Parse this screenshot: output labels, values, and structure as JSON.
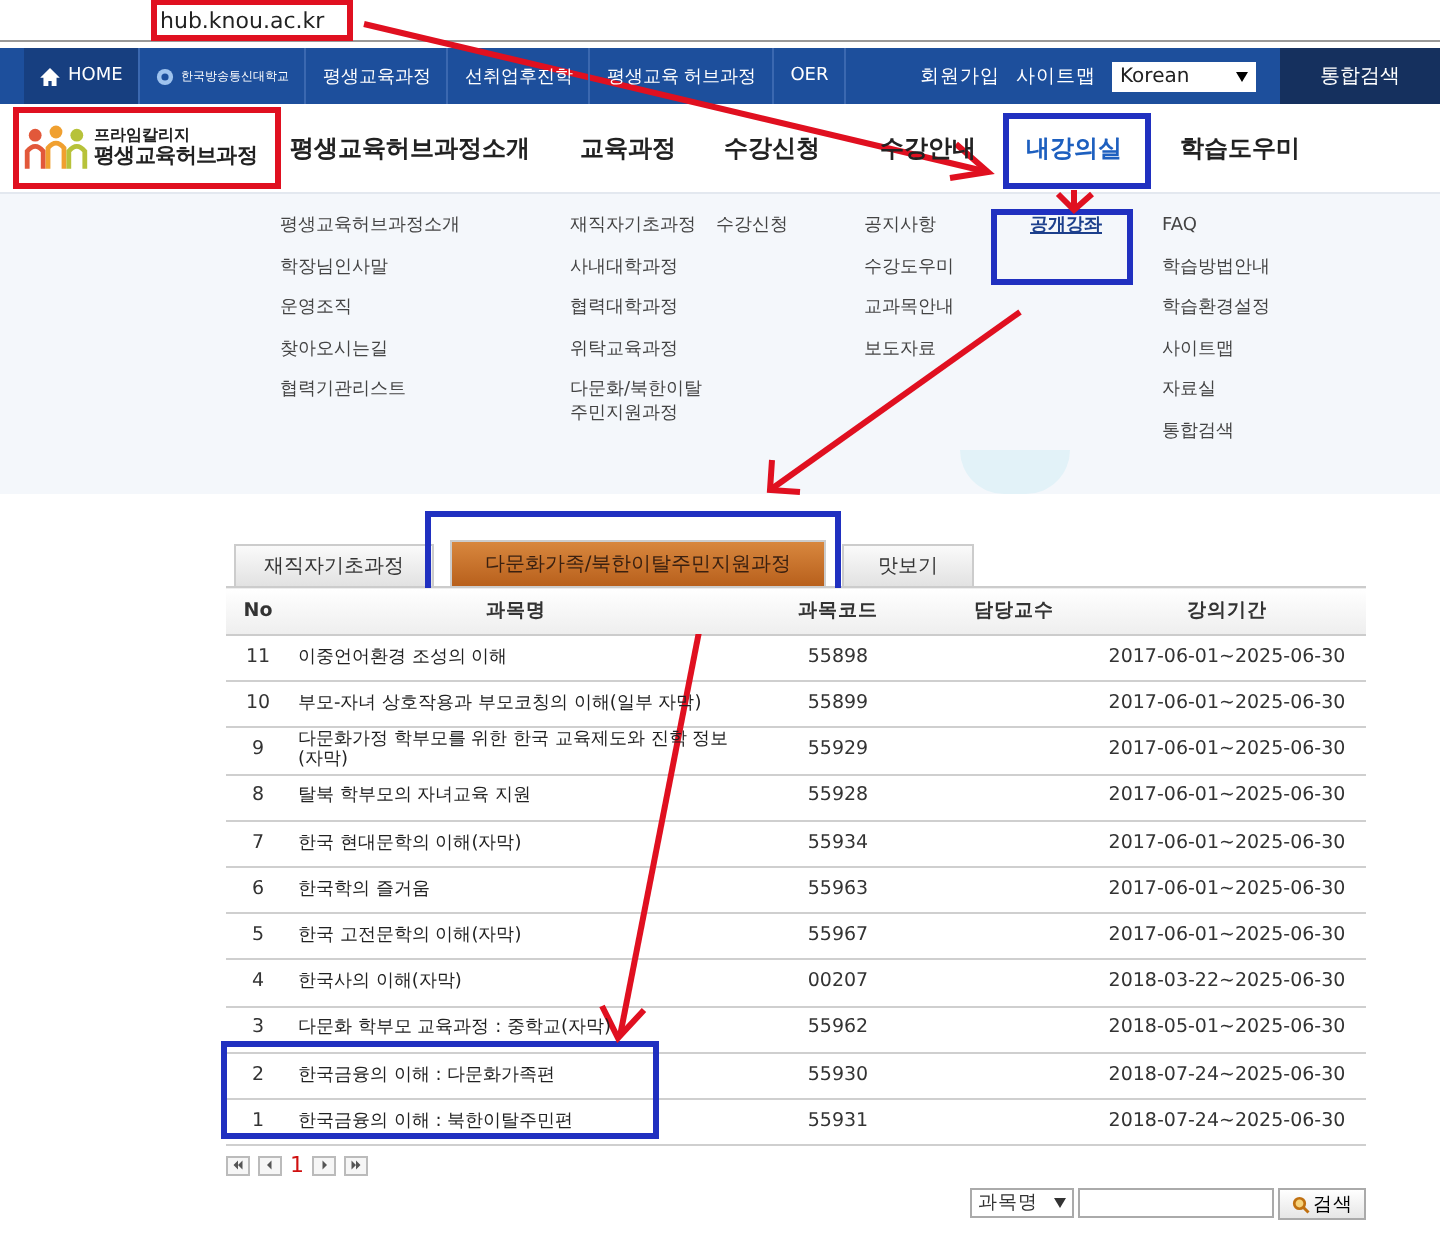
{
  "address_bar": {
    "url": "hub.knou.ac.kr"
  },
  "top_nav": {
    "items": [
      {
        "kind": "home",
        "label": "HOME"
      },
      {
        "kind": "logo",
        "label": "한국방송통신대학교"
      },
      {
        "kind": "link",
        "label": "평생교육과정"
      },
      {
        "kind": "link",
        "label": "선취업후진학"
      },
      {
        "kind": "link",
        "label": "평생교육 허브과정"
      },
      {
        "kind": "link",
        "label": "OER"
      }
    ],
    "links": [
      "회원가입",
      "사이트맵"
    ],
    "language_select": {
      "value": "Korean"
    },
    "search_button": "통합검색"
  },
  "header": {
    "logo": {
      "line1": "프라임칼리지",
      "line2": "평생교육허브과정"
    },
    "main_menu": [
      {
        "label": "평생교육허브과정소개",
        "selected": false
      },
      {
        "label": "교육과정",
        "selected": false
      },
      {
        "label": "수강신청",
        "selected": false
      },
      {
        "label": "수강안내",
        "selected": false
      },
      {
        "label": "내강의실",
        "selected": true
      },
      {
        "label": "학습도우미",
        "selected": false
      }
    ]
  },
  "mega_menu": [
    {
      "items": [
        {
          "label": "평생교육허브과정소개",
          "selected": false
        },
        {
          "label": "학장님인사말",
          "selected": false
        },
        {
          "label": "운영조직",
          "selected": false
        },
        {
          "label": "찾아오시는길",
          "selected": false
        },
        {
          "label": "협력기관리스트",
          "selected": false
        }
      ]
    },
    {
      "items": [
        {
          "label": "재직자기초과정",
          "selected": false
        },
        {
          "label": "사내대학과정",
          "selected": false
        },
        {
          "label": "협력대학과정",
          "selected": false
        },
        {
          "label": "위탁교육과정",
          "selected": false
        },
        {
          "label": "다문화/북한이탈\n주민지원과정",
          "selected": false
        }
      ]
    },
    {
      "items": [
        {
          "label": "수강신청",
          "selected": false
        }
      ]
    },
    {
      "items": [
        {
          "label": "공지사항",
          "selected": false
        },
        {
          "label": "수강도우미",
          "selected": false
        },
        {
          "label": "교과목안내",
          "selected": false
        },
        {
          "label": "보도자료",
          "selected": false
        }
      ]
    },
    {
      "items": [
        {
          "label": "공개강좌",
          "selected": true
        }
      ]
    },
    {
      "items": [
        {
          "label": "FAQ",
          "selected": false
        },
        {
          "label": "학습방법안내",
          "selected": false
        },
        {
          "label": "학습환경설정",
          "selected": false
        },
        {
          "label": "사이트맵",
          "selected": false
        },
        {
          "label": "자료실",
          "selected": false
        },
        {
          "label": "통합검색",
          "selected": false
        }
      ]
    }
  ],
  "tabs": [
    {
      "label": "재직자기초과정",
      "selected": false
    },
    {
      "label": "다문화가족/북한이탈주민지원과정",
      "selected": true
    },
    {
      "label": "맛보기",
      "selected": false
    }
  ],
  "table": {
    "columns": [
      "No",
      "과목명",
      "과목코드",
      "담당교수",
      "강의기간"
    ],
    "rows": [
      {
        "no": "11",
        "title": "이중언어환경 조성의 이해",
        "code": "55898",
        "period": "2017-06-01~2025-06-30"
      },
      {
        "no": "10",
        "title": "부모-자녀 상호작용과 부모코칭의 이해(일부 자막)",
        "code": "55899",
        "period": "2017-06-01~2025-06-30"
      },
      {
        "no": "9",
        "title": "다문화가정 학부모를 위한 한국 교육제도와 진학 정보(자막)",
        "code": "55929",
        "period": "2017-06-01~2025-06-30"
      },
      {
        "no": "8",
        "title": "탈북 학부모의 자녀교육 지원",
        "code": "55928",
        "period": "2017-06-01~2025-06-30"
      },
      {
        "no": "7",
        "title": "한국 현대문학의 이해(자막)",
        "code": "55934",
        "period": "2017-06-01~2025-06-30"
      },
      {
        "no": "6",
        "title": "한국학의 즐거움",
        "code": "55963",
        "period": "2017-06-01~2025-06-30"
      },
      {
        "no": "5",
        "title": "한국 고전문학의 이해(자막)",
        "code": "55967",
        "period": "2017-06-01~2025-06-30"
      },
      {
        "no": "4",
        "title": "한국사의 이해(자막)",
        "code": "00207",
        "period": "2018-03-22~2025-06-30"
      },
      {
        "no": "3",
        "title": "다문화 학부모 교육과정 : 중학교(자막)",
        "code": "55962",
        "period": "2018-05-01~2025-06-30"
      },
      {
        "no": "2",
        "title": "한국금융의 이해 : 다문화가족편",
        "code": "55930",
        "period": "2018-07-24~2025-06-30"
      },
      {
        "no": "1",
        "title": "한국금융의 이해 : 북한이탈주민편",
        "code": "55931",
        "period": "2018-07-24~2025-06-30"
      }
    ]
  },
  "pagination": {
    "pages": [
      {
        "label": "1",
        "selected": true
      }
    ]
  },
  "search": {
    "field_select": "과목명",
    "button": "검색"
  }
}
